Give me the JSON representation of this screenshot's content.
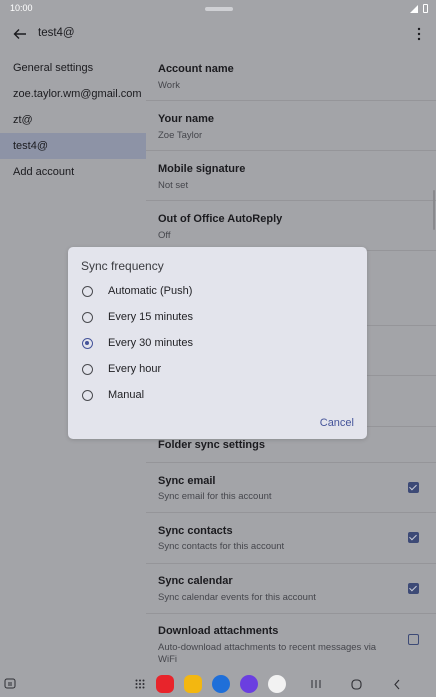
{
  "status": {
    "time": "10:00"
  },
  "appbar": {
    "title": "test4@"
  },
  "accounts": [
    {
      "label": "General settings",
      "selected": false
    },
    {
      "label": "zoe.taylor.wm@gmail.com",
      "selected": false
    },
    {
      "label": "zt@",
      "selected": false
    },
    {
      "label": "test4@",
      "selected": true
    },
    {
      "label": "Add account",
      "selected": false
    }
  ],
  "settings": {
    "account_name": {
      "title": "Account name",
      "value": "Work"
    },
    "your_name": {
      "title": "Your name",
      "value": "Zoe Taylor"
    },
    "signature": {
      "title": "Mobile signature",
      "value": "Not set"
    },
    "ooo": {
      "title": "Out of Office AutoReply",
      "value": "Off"
    },
    "folder_sync": {
      "title": "Folder sync settings"
    },
    "sync_email": {
      "title": "Sync email",
      "sub": "Sync email for this account",
      "checked": true
    },
    "sync_contacts": {
      "title": "Sync contacts",
      "sub": "Sync contacts for this account",
      "checked": true
    },
    "sync_calendar": {
      "title": "Sync calendar",
      "sub": "Sync calendar events for this account",
      "checked": true
    },
    "download_attachments": {
      "title": "Download attachments",
      "sub": "Auto-download attachments to recent messages via WiFi",
      "checked": false
    }
  },
  "dialog": {
    "title": "Sync frequency",
    "options": [
      {
        "label": "Automatic (Push)",
        "selected": false
      },
      {
        "label": "Every 15 minutes",
        "selected": false
      },
      {
        "label": "Every 30 minutes",
        "selected": true
      },
      {
        "label": "Every hour",
        "selected": false
      },
      {
        "label": "Manual",
        "selected": false
      }
    ],
    "cancel": "Cancel"
  },
  "colors": {
    "accent": "#45549a",
    "scrim": "#a3a4a8",
    "dialog_bg": "#e3e4ec"
  },
  "navbar": {
    "apps": [
      "red-app-icon",
      "yellow-app-icon",
      "blue-chat-app-icon",
      "purple-browser-app-icon",
      "camera-app-icon"
    ]
  }
}
